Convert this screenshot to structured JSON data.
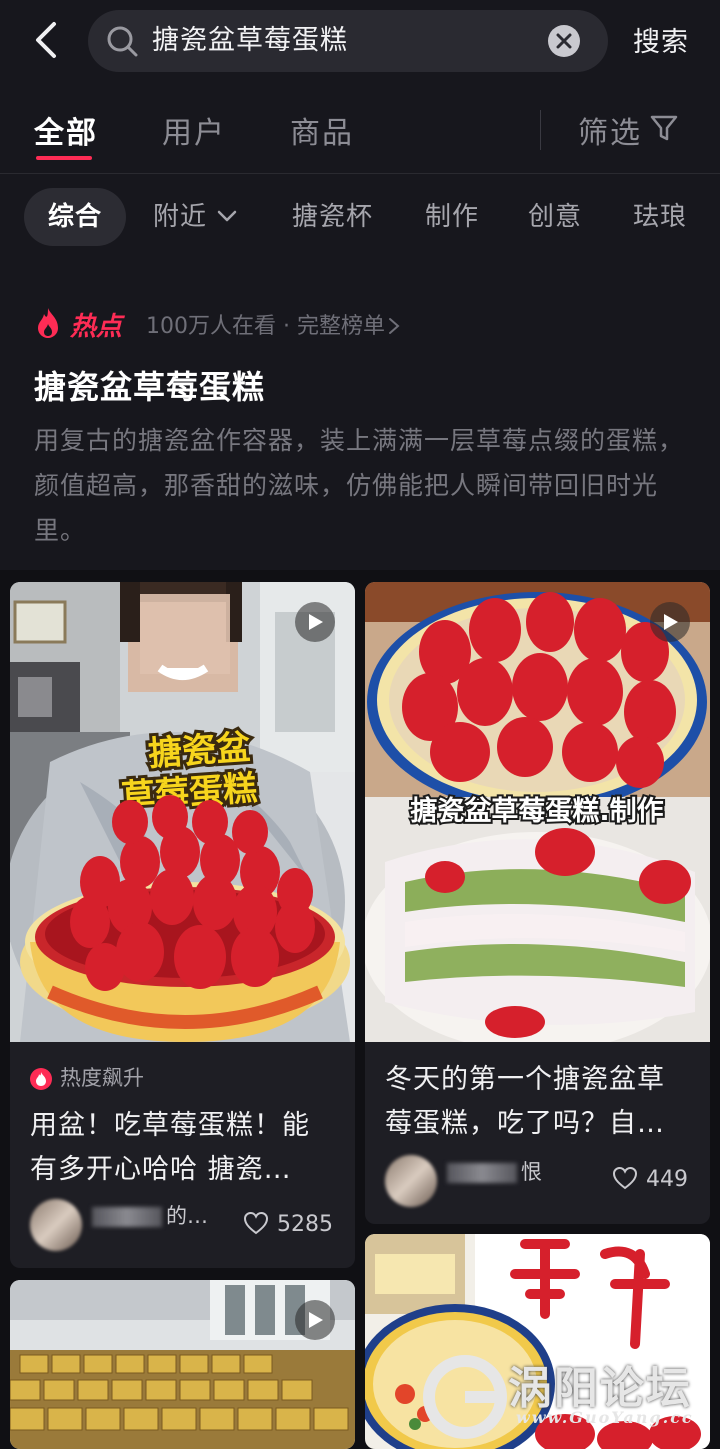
{
  "search": {
    "query": "搪瓷盆草莓蛋糕",
    "button": "搜索"
  },
  "tabs": [
    {
      "label": "全部",
      "active": true
    },
    {
      "label": "用户",
      "active": false
    },
    {
      "label": "商品",
      "active": false
    }
  ],
  "filter_label": "筛选",
  "chips": [
    {
      "label": "综合",
      "active": true
    },
    {
      "label": "附近",
      "active": false,
      "dropdown": true
    },
    {
      "label": "搪瓷杯",
      "active": false
    },
    {
      "label": "制作",
      "active": false
    },
    {
      "label": "创意",
      "active": false
    },
    {
      "label": "珐琅",
      "active": false
    }
  ],
  "hot": {
    "label": "热点",
    "meta": "100万人在看 · 完整榜单",
    "title": "搪瓷盆草莓蛋糕",
    "description": "用复古的搪瓷盆作容器，装上满满一层草莓点缀的蛋糕，颜值超高，那香甜的滋味，仿佛能把人瞬间带回旧时光里。"
  },
  "cards": [
    {
      "overlay_line1": "搪瓷盆",
      "overlay_line2": "草莓蛋糕",
      "badge": "热度飙升",
      "title": "用盆！吃草莓蛋糕！能有多开心哈哈 搪瓷…",
      "author_suffix": "的…",
      "likes": "5285"
    },
    {
      "overlay_text": "搪瓷盆草莓蛋糕.制作",
      "title": "冬天的第一个搪瓷盆草莓蛋糕，吃了吗？自…",
      "author_suffix": "恨",
      "likes": "449"
    },
    {},
    {}
  ],
  "watermark": {
    "text": "涡阳论坛",
    "url": "www.GuoYang.cc"
  },
  "colors": {
    "accent": "#fe2c55",
    "background": "#17171d",
    "card": "#1e1e24"
  }
}
